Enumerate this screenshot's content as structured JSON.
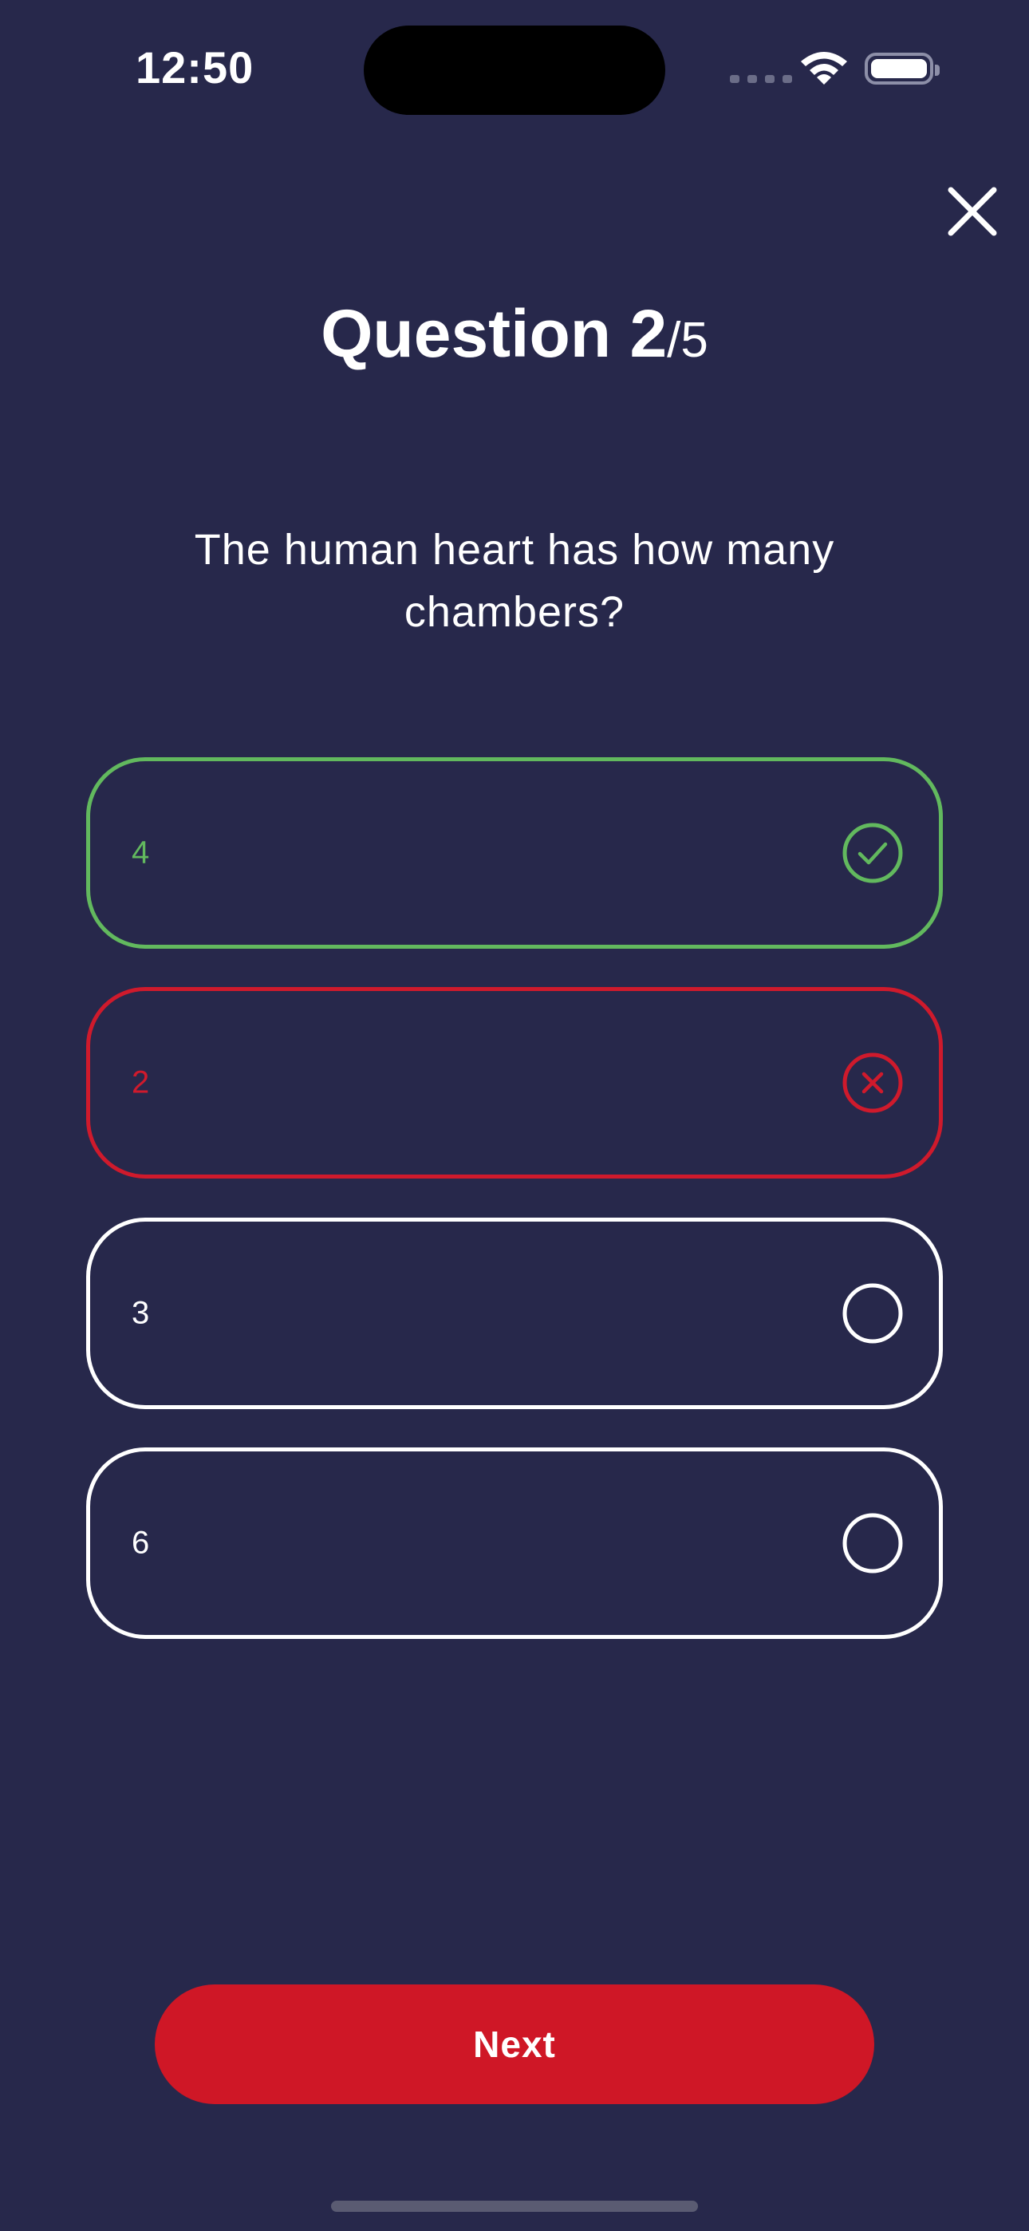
{
  "status_bar": {
    "time": "12:50"
  },
  "quiz": {
    "title_prefix": "Question ",
    "current": "2",
    "total": "/5",
    "question": "The human heart has how many chambers?",
    "options": [
      {
        "label": "4",
        "state": "correct",
        "icon": "check-circle-icon"
      },
      {
        "label": "2",
        "state": "wrong",
        "icon": "x-circle-icon"
      },
      {
        "label": "3",
        "state": "unselected",
        "icon": "empty-circle-icon"
      },
      {
        "label": "6",
        "state": "unselected",
        "icon": "empty-circle-icon"
      }
    ],
    "next_label": "Next"
  },
  "colors": {
    "background": "#27284b",
    "correct": "#62b95e",
    "wrong": "#cf1a2c",
    "accent_button": "#cf1726"
  }
}
